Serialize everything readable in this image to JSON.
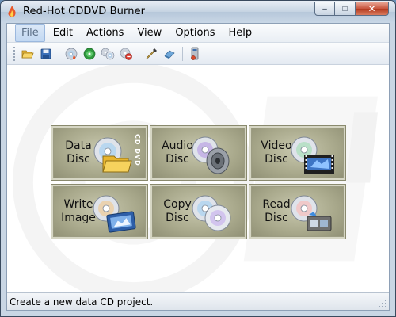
{
  "window": {
    "title": "Red-Hot CDDVD Burner",
    "controls": {
      "minimize": "–",
      "maximize": "□",
      "close": "✕"
    }
  },
  "menu": [
    {
      "label": "File",
      "active": true
    },
    {
      "label": "Edit"
    },
    {
      "label": "Actions"
    },
    {
      "label": "View"
    },
    {
      "label": "Options"
    },
    {
      "label": "Help"
    }
  ],
  "toolbar": [
    {
      "icon": "open-folder-icon"
    },
    {
      "icon": "save-icon"
    },
    {
      "icon": "burn-disc-icon"
    },
    {
      "icon": "play-disc-icon"
    },
    {
      "icon": "copy-disc-icon"
    },
    {
      "icon": "erase-disc-icon"
    },
    {
      "icon": "eyedropper-icon"
    },
    {
      "icon": "eraser-icon"
    },
    {
      "icon": "drive-icon"
    }
  ],
  "tiles": [
    {
      "line1": "Data",
      "line2": "Disc",
      "badge": "CD DVD",
      "icon": "data-disc-icon"
    },
    {
      "line1": "Audio",
      "line2": "Disc",
      "icon": "audio-disc-icon"
    },
    {
      "line1": "Video",
      "line2": "Disc",
      "icon": "video-disc-icon"
    },
    {
      "line1": "Write",
      "line2": "Image",
      "icon": "write-image-icon"
    },
    {
      "line1": "Copy",
      "line2": "Disc",
      "icon": "copy-disc-tile-icon"
    },
    {
      "line1": "Read",
      "line2": "Disc",
      "icon": "read-disc-icon"
    }
  ],
  "status": {
    "text": "Create a new data CD project."
  },
  "colors": {
    "tile_fill": "#a9a98c",
    "close_button": "#c7523a",
    "menu_active": "#c2d8f2"
  }
}
